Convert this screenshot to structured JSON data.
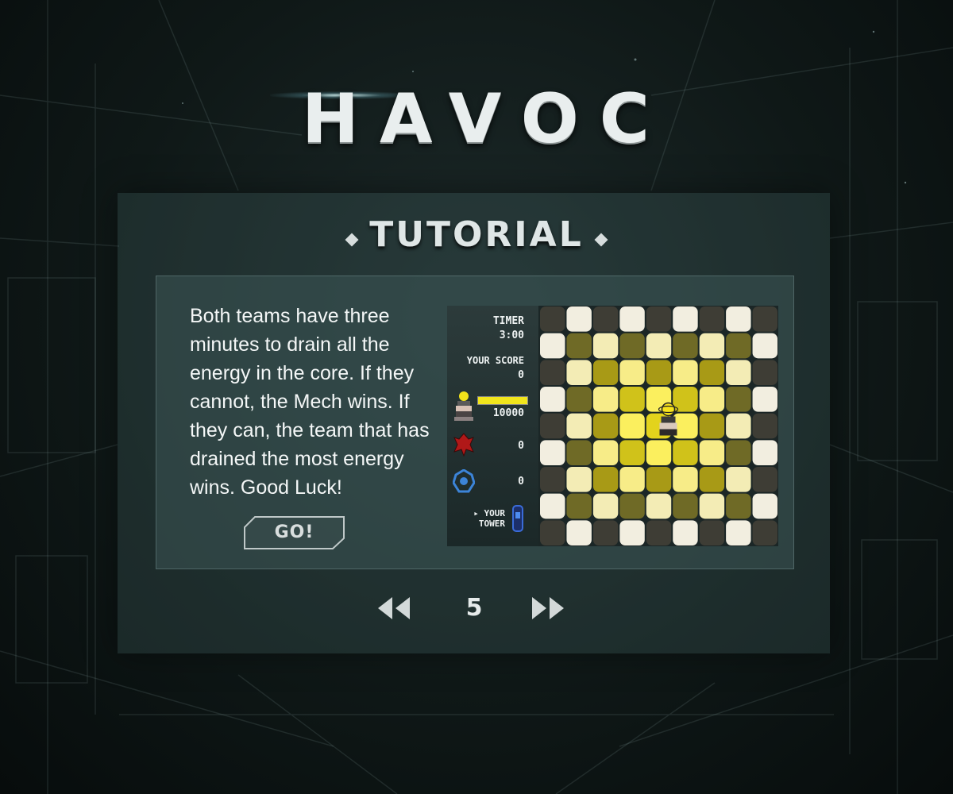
{
  "game": {
    "title": "HAVOC"
  },
  "screen": {
    "heading": "TUTORIAL",
    "description": "Both teams have three minutes to drain all the energy in the core. If they cannot, the Mech wins. If they can, the team that has drained the most energy wins. Good Luck!",
    "go_label": "GO!",
    "page": "5",
    "prev_icon": "double-chevron-left-icon",
    "next_icon": "double-chevron-right-icon"
  },
  "preview": {
    "timer_label": "TIMER",
    "timer_value": "3:00",
    "score_label": "YOUR SCORE",
    "score_value": "0",
    "core_energy": "10000",
    "core_energy_fraction": 1.0,
    "red_team_score": "0",
    "blue_team_score": "0",
    "your_tower_label_1": "YOUR",
    "your_tower_label_2": "TOWER",
    "icons": [
      "core-tower-icon",
      "red-team-icon",
      "blue-team-icon",
      "your-tower-icon"
    ]
  },
  "colors": {
    "accent_yellow": "#f1e51c",
    "panel": "#2f4443",
    "text": "#eef2f2"
  }
}
